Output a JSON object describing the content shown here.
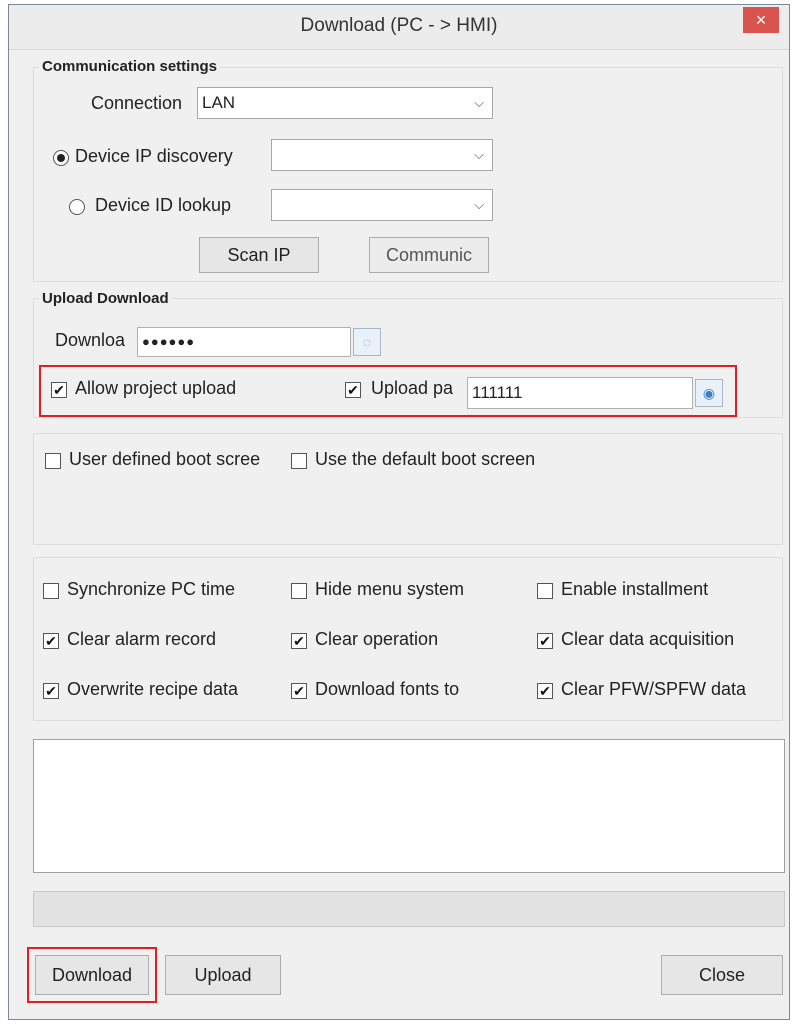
{
  "window": {
    "title": "Download (PC - > HMI)",
    "close_glyph": "×"
  },
  "communication": {
    "group_title": "Communication settings",
    "connection_label": "Connection",
    "connection_value": "LAN",
    "device_ip_label": "Device IP discovery",
    "device_ip_value": "",
    "device_id_label": "Device ID lookup",
    "device_id_value": "",
    "scan_ip_label": "Scan IP",
    "communic_label": "Communic",
    "selected_mode": "device_ip_discovery"
  },
  "upload_download": {
    "group_title": "Upload  Download",
    "download_password_label": "Downloa",
    "download_password_value": "●●●●●●",
    "allow_upload_label": "Allow project upload",
    "allow_upload_checked": true,
    "upload_password_label": "Upload pa",
    "upload_password_checked": true,
    "upload_password_value": "111111"
  },
  "boot_screen": {
    "user_defined_label": "User defined boot scree",
    "user_defined_checked": false,
    "default_label": "Use the default boot screen",
    "default_checked": false
  },
  "options": [
    {
      "label": "Synchronize PC time",
      "checked": false
    },
    {
      "label": "Hide menu system",
      "checked": false
    },
    {
      "label": "Enable installment",
      "checked": false
    },
    {
      "label": "Clear alarm record",
      "checked": true
    },
    {
      "label": "Clear operation",
      "checked": true
    },
    {
      "label": "Clear data acquisition",
      "checked": true
    },
    {
      "label": "Overwrite recipe data",
      "checked": true
    },
    {
      "label": "Download fonts to",
      "checked": true
    },
    {
      "label": "Clear PFW/SPFW data",
      "checked": true
    }
  ],
  "buttons": {
    "download": "Download",
    "upload": "Upload",
    "close": "Close"
  },
  "check_glyph": "✔",
  "icons": {
    "eye_hidden": "eye-slash-icon",
    "eye_visible": "eye-icon",
    "dropdown": "chevron-down-icon"
  },
  "colors": {
    "highlight_border": "#e02020",
    "title_close_bg": "#d9534f"
  }
}
